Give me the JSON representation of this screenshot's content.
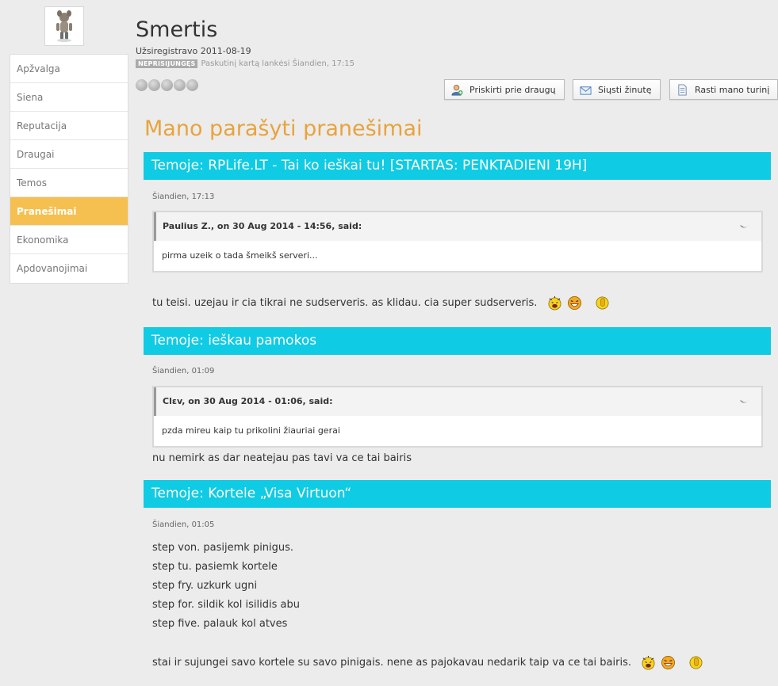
{
  "profile": {
    "username": "Smertis",
    "registered": "Užsiregistravo 2011-08-19",
    "status_badge": "NEPRISIJUNGĘS",
    "last_visit": "Paskutinį kartą lankėsi Šiandien, 17:15"
  },
  "sidebar": {
    "items": [
      {
        "label": "Apžvalga"
      },
      {
        "label": "Siena"
      },
      {
        "label": "Reputacija"
      },
      {
        "label": "Draugai"
      },
      {
        "label": "Temos"
      },
      {
        "label": "Pranešimai"
      },
      {
        "label": "Ekonomika"
      },
      {
        "label": "Apdovanojimai"
      }
    ],
    "active_index": 5
  },
  "actions": {
    "add_friend": "Priskirti prie draugų",
    "send_message": "Siųsti žinutę",
    "find_content": "Rasti mano turinį"
  },
  "section_title": "Mano parašyti pranešimai",
  "posts": [
    {
      "topic": "Temoje: RPLife.LT - Tai ko ieškai tu! [STARTAS: PENKTADIENI 19H]",
      "date": "Šiandien, 17:13",
      "quote_author": "Paulius Z., on 30 Aug 2014 - 14:56, said:",
      "quote_text": "pirma uzeik o tada šmeikš serveri...",
      "text": "tu teisi. uzejau ir cia tikrai ne sudserveris. as klidau. cia super sudserveris."
    },
    {
      "topic": "Temoje: ieškau pamokos",
      "date": "Šiandien, 01:09",
      "quote_author": "Clεv, on 30 Aug 2014 - 01:06, said:",
      "quote_text": "pzda mireu kaip tu prikolini žiauriai gerai",
      "text": "nu nemirk as dar neatejau pas tavi va ce tai bairis"
    },
    {
      "topic": "Temoje: Kortele „Visa Virtuon“",
      "date": "Šiandien, 01:05",
      "lines": [
        "step von. pasijemk pinigus.",
        "step tu. pasiemk kortele",
        "step fry. uzkurk ugni",
        "step for. sildik kol isilidis abu",
        "step five. palauk kol atves"
      ],
      "text": "stai ir sujungei savo kortele su savo pinigais. nene as pajokavau nedarik taip va ce tai bairis."
    }
  ],
  "colors": {
    "accent": "#e8a33d",
    "topic_bar": "#10cbe4",
    "active_nav": "#f5c04f"
  }
}
